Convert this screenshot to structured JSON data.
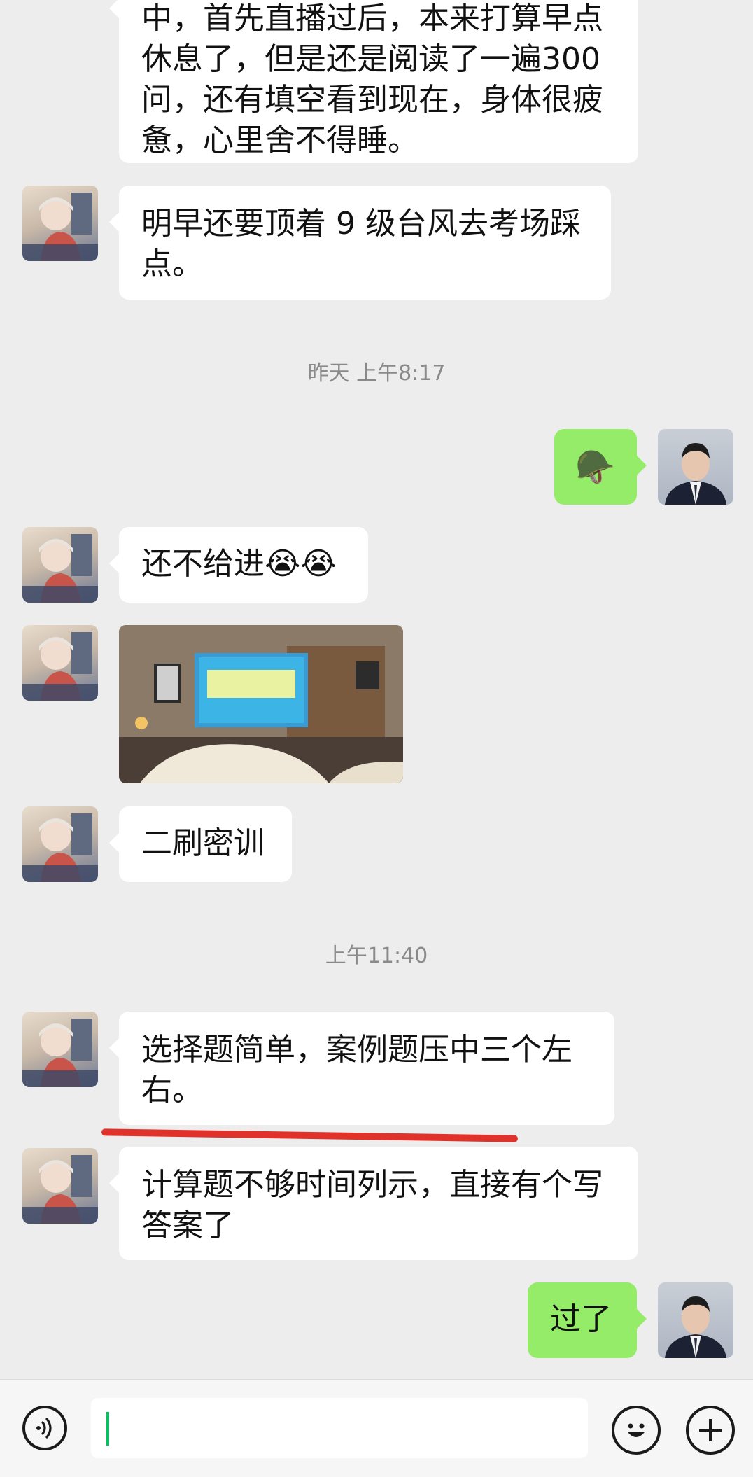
{
  "messages": {
    "m0": {
      "line1": "中，首先直播过后，本来打算早点",
      "line2": "休息了，但是还是阅读了一遍300",
      "line3": "问，还有填空看到现在，身体很疲",
      "line4": "惫，心里舍不得睡。"
    },
    "m1": {
      "line1": "明早还要顶着 9 级台风去考场踩",
      "line2": "点。"
    },
    "m2": {
      "emoji": "🪖"
    },
    "m3": {
      "text": "还不给进",
      "emoji": "😭😭"
    },
    "m5": {
      "text": "二刷密训"
    },
    "m6": {
      "line1": "选择题简单，案例题压中三个左",
      "line2": "右。"
    },
    "m7": {
      "line1": "计算题不够时间列示，直接有个写",
      "line2": "答案了"
    },
    "m8": {
      "text": "过了"
    }
  },
  "timestamps": {
    "t1": "昨天 上午8:17",
    "t2": "上午11:40"
  },
  "colors": {
    "background": "#ededed",
    "incoming_bubble": "#ffffff",
    "outgoing_bubble": "#95ec69",
    "underline": "#e0322a",
    "cursor": "#07c160"
  },
  "icons": {
    "voice": "voice-mode-icon",
    "emoji": "emoji-smile-icon",
    "plus": "plus-icon"
  }
}
